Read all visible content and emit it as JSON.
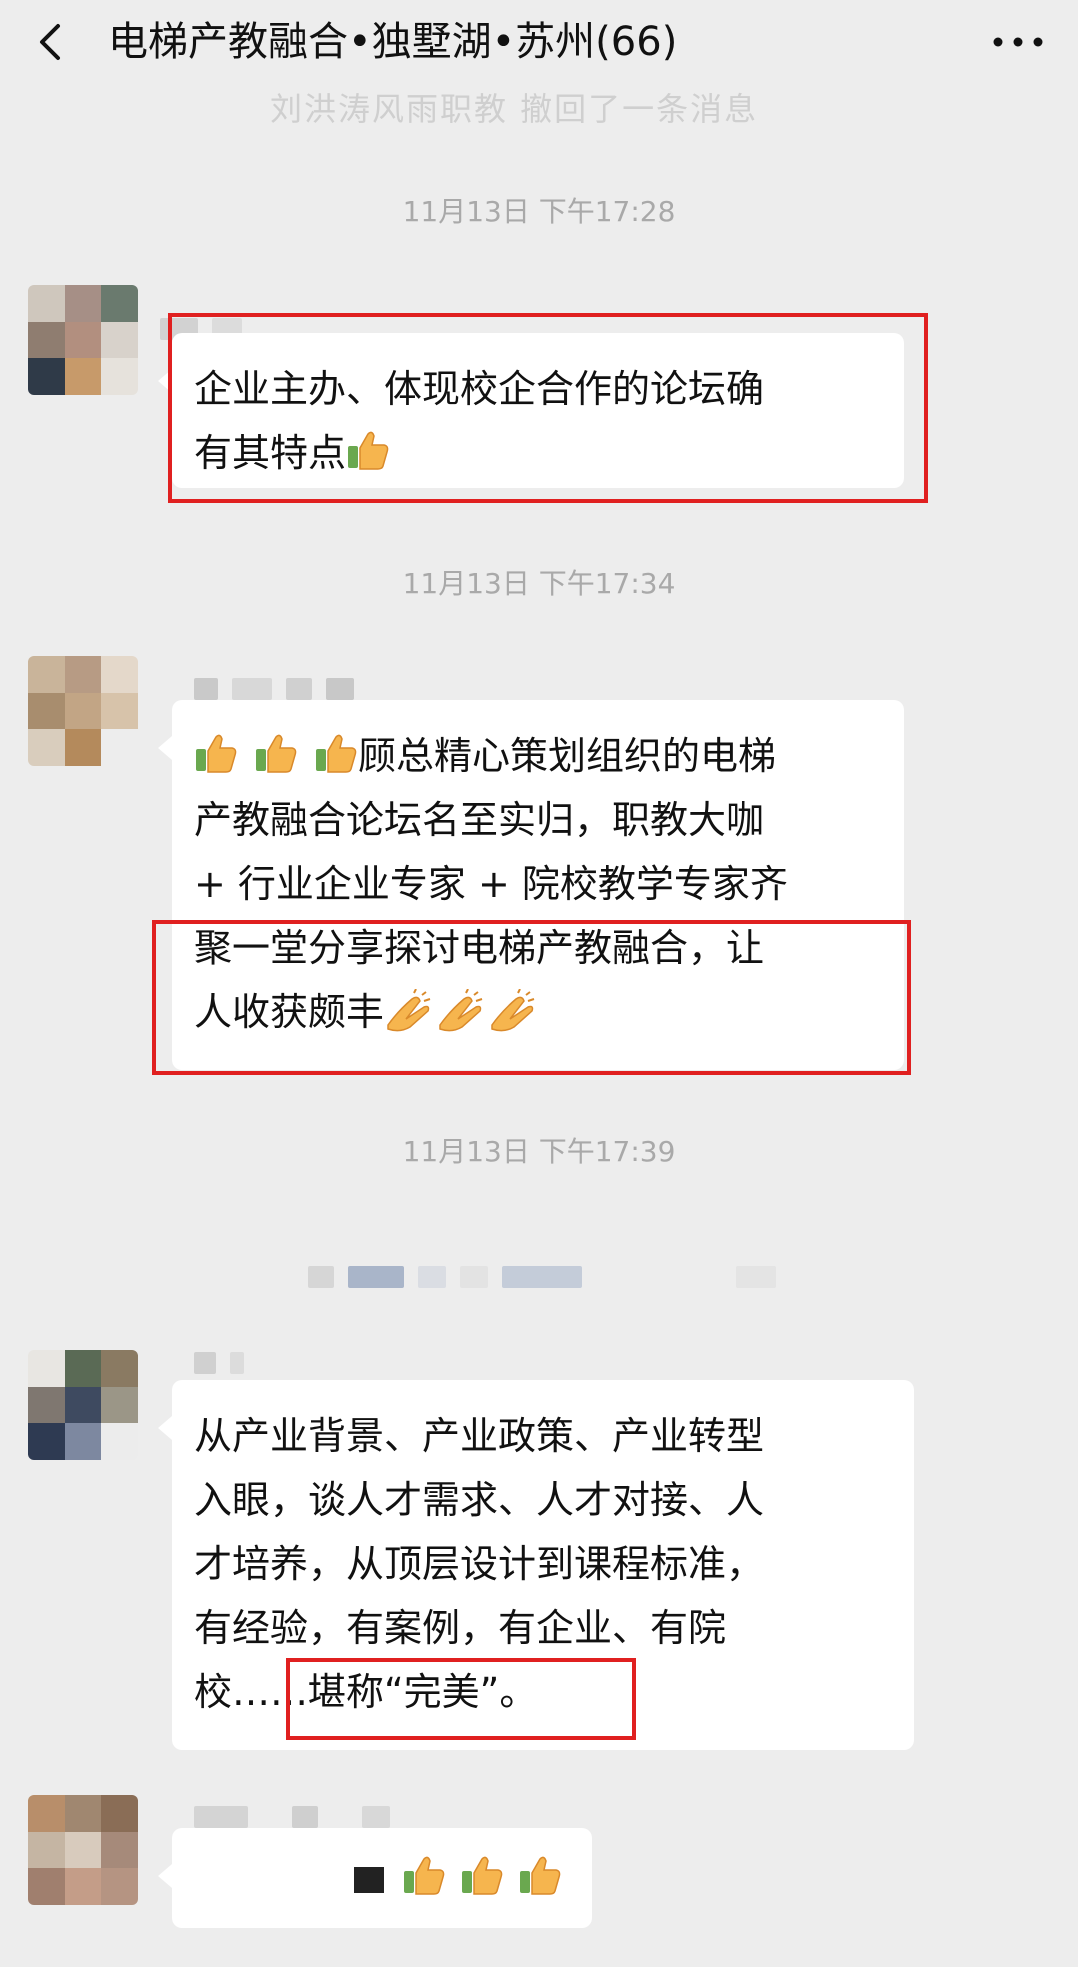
{
  "header": {
    "title": "电梯产教融合•独墅湖•苏州(66)",
    "back_icon": "chevron-left-icon",
    "more_icon": "ellipsis-icon"
  },
  "ghost_banner": "刘洪涛风雨职教  撤回了一条消息",
  "messages": [
    {
      "timestamp": "11月13日 下午17:28",
      "lines": [
        "企业主办、体现校企合作的论坛确",
        "有其特点"
      ],
      "trailing_emoji": [
        "thumbs-up"
      ]
    },
    {
      "timestamp": "11月13日 下午17:34",
      "leading_emoji": [
        "thumbs-up",
        "thumbs-up",
        "thumbs-up"
      ],
      "lines": [
        "顾总精心策划组织的电梯",
        "产教融合论坛名至实归，职教大咖",
        "+ 行业企业专家 + 院校教学专家齐",
        "聚一堂分享探讨电梯产教融合，让",
        "人收获颇丰"
      ],
      "trailing_emoji": [
        "clap",
        "clap",
        "clap"
      ]
    },
    {
      "timestamp": "11月13日 下午17:39",
      "lines": [
        "从产业背景、产业政策、产业转型",
        "入眼，谈人才需求、人才对接、人",
        "才培养，从顶层设计到课程标准，",
        "有经验，有案例，有企业、有院",
        "校……堪称“完美”。"
      ]
    },
    {
      "trailing_emoji": [
        "thumbs-up",
        "thumbs-up",
        "thumbs-up"
      ]
    }
  ],
  "colors": {
    "background": "#ededed",
    "bubble": "#ffffff",
    "highlight": "#e02020",
    "timestamp": "#a9a9a9"
  }
}
